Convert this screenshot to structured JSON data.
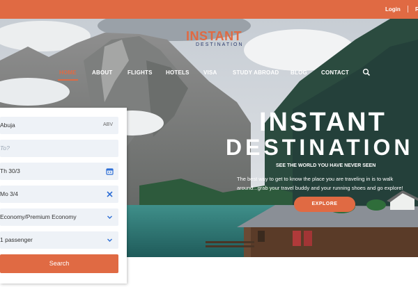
{
  "topbar": {
    "login": "Login",
    "register": "R"
  },
  "logo": {
    "main": "INSTANT",
    "sub": "DESTINATION"
  },
  "nav": {
    "items": [
      "HOME",
      "ABOUT",
      "FLIGHTS",
      "HOTELS",
      "VISA",
      "STUDY ABROAD",
      "BLOG",
      "CONTACT"
    ],
    "active": "HOME"
  },
  "hero": {
    "title_line1": "INSTANT",
    "title_line2": "DESTINATION",
    "tagline": "SEE THE WORLD YOU HAVE NEVER SEEN",
    "description": "The best way to get to know the place you are traveling in is to walk around...grab your travel buddy and your running shoes and go explore!",
    "cta": "EXPLORE"
  },
  "search": {
    "from_value": "Abuja",
    "from_code": "ABV",
    "to_placeholder": "To?",
    "depart_date": "Th 30/3",
    "return_date": "Mo 3/4",
    "cabin_class": "Economy/Premium Economy",
    "passengers": "1 passenger",
    "submit": "Search"
  },
  "colors": {
    "accent": "#e06a43",
    "field_bg": "#eef2f7",
    "icon_blue": "#2f6fd6"
  }
}
